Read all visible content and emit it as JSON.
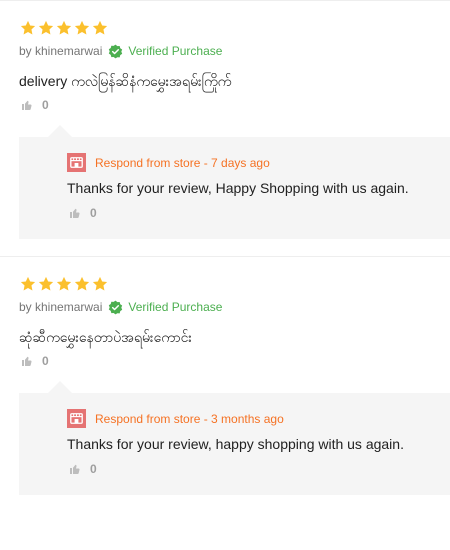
{
  "reviews": [
    {
      "rating": 5,
      "author": "by khinemarwai",
      "verified_label": "Verified Purchase",
      "content": "delivery ကလဲမြန်ဆိနံကမွှေးအရမ်းကြိုက်",
      "likes": "0",
      "response": {
        "label": "Respond from store - 7 days ago",
        "text": "Thanks for your review, Happy Shopping with us again.",
        "likes": "0"
      }
    },
    {
      "rating": 5,
      "author": "by khinemarwai",
      "verified_label": "Verified Purchase",
      "content": "ဆုံဆီကမွှေးနေတာပဲအရမ်းကောင်း",
      "likes": "0",
      "response": {
        "label": "Respond from store - 3 months ago",
        "text": "Thanks for your review, happy shopping with us again.",
        "likes": "0"
      }
    }
  ],
  "colors": {
    "star": "#fbc02d",
    "verified": "#4caf50",
    "response_label": "#f57224",
    "response_bg": "#f5f5f5",
    "store_icon": "#e57373",
    "like_icon": "#bdbdbd"
  },
  "icons": {
    "star": "star-icon",
    "verified": "verified-check-icon",
    "like": "thumbs-up-icon",
    "store": "store-icon"
  }
}
